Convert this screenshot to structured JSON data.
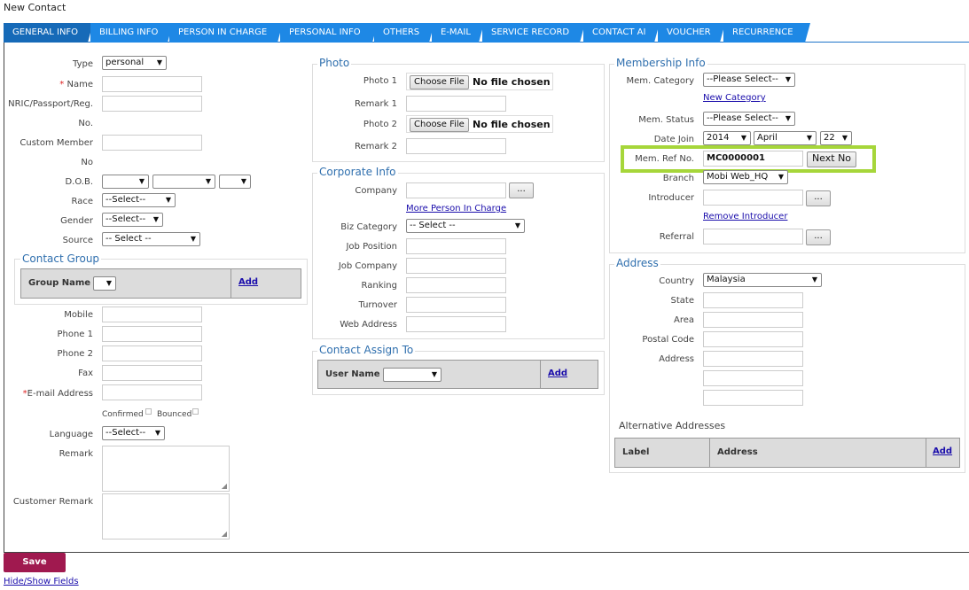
{
  "page_title": "New Contact",
  "tabs": [
    {
      "label": "GENERAL INFO",
      "active": true
    },
    {
      "label": "BILLING INFO"
    },
    {
      "label": "PERSON IN CHARGE"
    },
    {
      "label": "PERSONAL INFO"
    },
    {
      "label": "OTHERS"
    },
    {
      "label": "E-MAIL"
    },
    {
      "label": "SERVICE RECORD"
    },
    {
      "label": "CONTACT AI"
    },
    {
      "label": "VOUCHER"
    },
    {
      "label": "RECURRENCE"
    }
  ],
  "general": {
    "type_label": "Type",
    "type_value": "personal",
    "name_label": "Name",
    "required_mark": "*",
    "nric_label_1": "NRIC/Passport/Reg.",
    "nric_label_2": "No.",
    "custom_member_label_1": "Custom Member",
    "custom_member_label_2": "No",
    "dob_label": "D.O.B.",
    "race_label": "Race",
    "race_value": "--Select--",
    "gender_label": "Gender",
    "gender_value": "--Select--",
    "source_label": "Source",
    "source_value": "-- Select --"
  },
  "contact_group": {
    "legend": "Contact Group",
    "group_name_label": "Group Name",
    "add_label": "Add"
  },
  "contact_fields": {
    "mobile_label": "Mobile",
    "phone1_label": "Phone 1",
    "phone2_label": "Phone 2",
    "fax_label": "Fax",
    "email_label": "E-mail Address",
    "confirmed_label": "Confirmed",
    "bounced_label": "Bounced",
    "language_label": "Language",
    "language_value": "--Select--",
    "remark_label": "Remark",
    "customer_remark_label": "Customer Remark"
  },
  "photo": {
    "legend": "Photo",
    "photo1_label": "Photo 1",
    "remark1_label": "Remark 1",
    "photo2_label": "Photo 2",
    "remark2_label": "Remark 2",
    "choose_file_label": "Choose File",
    "no_file_text": "No file chosen"
  },
  "corporate": {
    "legend": "Corporate Info",
    "company_label": "Company",
    "browse_label": "...",
    "more_pic_link": "More Person In Charge",
    "biz_category_label": "Biz Category",
    "biz_category_value": "-- Select --",
    "job_position_label": "Job Position",
    "job_company_label": "Job Company",
    "ranking_label": "Ranking",
    "turnover_label": "Turnover",
    "web_address_label": "Web Address"
  },
  "assign": {
    "legend": "Contact Assign To",
    "user_name_label": "User Name",
    "add_label": "Add"
  },
  "membership": {
    "legend": "Membership Info",
    "category_label": "Mem. Category",
    "category_value": "--Please Select--",
    "new_category_link": "New Category",
    "status_label": "Mem. Status",
    "status_value": "--Please Select--",
    "date_join_label": "Date Join",
    "year": "2014",
    "month": "April",
    "day": "22",
    "ref_label": "Mem. Ref No.",
    "ref_value": "MC0000001",
    "next_no_label": "Next No",
    "branch_label": "Branch",
    "branch_value": "Mobi Web_HQ",
    "introducer_label": "Introducer",
    "browse_label": "...",
    "remove_introducer_link": "Remove Introducer",
    "referral_label": "Referral",
    "highlight_color": "#a6d63a"
  },
  "address": {
    "legend": "Address",
    "country_label": "Country",
    "country_value": "Malaysia",
    "state_label": "State",
    "area_label": "Area",
    "postal_code_label": "Postal Code",
    "address_label": "Address",
    "alt_title": "Alternative Addresses",
    "alt_label_col": "Label",
    "alt_address_col": "Address",
    "alt_add_label": "Add"
  },
  "footer": {
    "save_label": "Save",
    "hide_show_link": "Hide/Show Fields",
    "save_color": "#a0194f"
  }
}
